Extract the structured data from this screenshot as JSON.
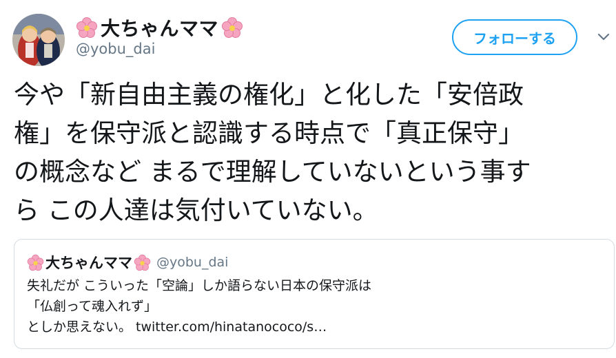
{
  "user": {
    "display_name": "大ちゃんママ",
    "handle": "@yobu_dai",
    "name_decoration": "cherry-blossom-emoji"
  },
  "actions": {
    "follow_label": "フォローする",
    "menu_icon": "chevron-down-icon"
  },
  "tweet": {
    "lines": [
      "今や「新自由主義の権化」と化した「安倍政",
      "権」を保守派と認識する時点で「真正保守」",
      "の概念など まるで理解していないという事す",
      "ら この人達は気付いていない。"
    ]
  },
  "quoted_tweet": {
    "display_name": "大ちゃんママ",
    "handle": "@yobu_dai",
    "lines": [
      "失礼だが こういった「空論」しか語らない日本の保守派は",
      "「仏創って魂入れず」",
      "としか思えない。 twitter.com/hinatanococo/s…"
    ]
  },
  "colors": {
    "accent": "#1da1f2",
    "text": "#14171a",
    "secondary": "#657786",
    "border": "#d4dbe0",
    "blossom": "#f6a5c0"
  }
}
